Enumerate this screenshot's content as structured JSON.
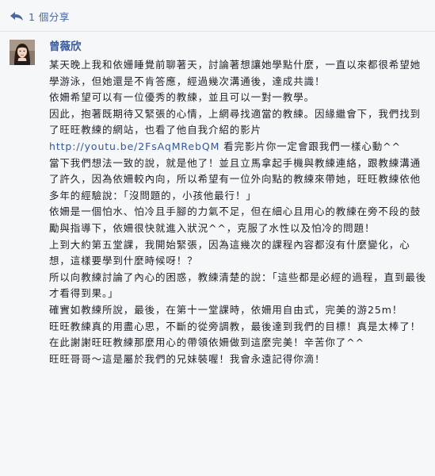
{
  "share": {
    "count_label": "1 個分享",
    "icon": "share-arrow-icon"
  },
  "comment": {
    "author": "曾薇欣",
    "avatar_icon": "profile-photo",
    "paragraphs": [
      {
        "text": "某天晚上我和依姗睡覺前聊著天，討論著想讓她學點什麼，一直以來都很希望她學游泳，但她還是不肯答應，經過幾次溝通後，達成共識！"
      },
      {
        "text": "依姍希望可以有一位優秀的教練，並且可以一對一教學。"
      },
      {
        "text": "因此，抱著既期待又緊張的心情，上網尋找適當的教練。因緣繼會下，我們找到了旺旺教練的網站，也看了他自我介紹的影片"
      },
      {
        "link": "http://youtu.be/2FsAqMRebQM",
        "text": " 看完影片你一定會跟我們一樣心動^^"
      },
      {
        "text": "當下我們想法一致的說，就是他了！並且立馬拿起手機與教練連絡，跟教練溝通了許久，因為依姍較內向，所以希望有一位外向點的教練來帶她，旺旺教練依他多年的經驗說：「沒問題的，小孩他最行！」"
      },
      {
        "text": "依姍是一個怕水、怕冷且手腳的力氣不足，但在細心且用心的教練在旁不段的鼓勵與指導下，依姍很快就進入狀況^^，克服了水性以及怕冷的問題！"
      },
      {
        "text": "上到大約第五堂課，我開始緊張，因為這幾次的課程內容都沒有什麼變化，心想，這樣要學到什麼時候呀！？"
      },
      {
        "text": "所以向教練討論了內心的困惑，教練清楚的說：「這些都是必經的過程，直到最後才看得到果。」"
      },
      {
        "text": "確實如教練所說，最後，在第十一堂課時，依姍用自由式，完美的游25m！"
      },
      {
        "text": "旺旺教練真的用盡心思，不斷的從旁調教，最後達到我們的目標！真是太棒了！"
      },
      {
        "text": "在此謝謝旺旺教練那麼用心的帶領依姍做到這麼完美！辛苦你了^^"
      },
      {
        "text": "旺旺哥哥～這是屬於我們的兄妹裝喔！我會永遠記得你滴！"
      }
    ]
  },
  "colors": {
    "link": "#365899",
    "author": "#365899",
    "text": "#1d2129",
    "background": "#f6f7f9"
  }
}
